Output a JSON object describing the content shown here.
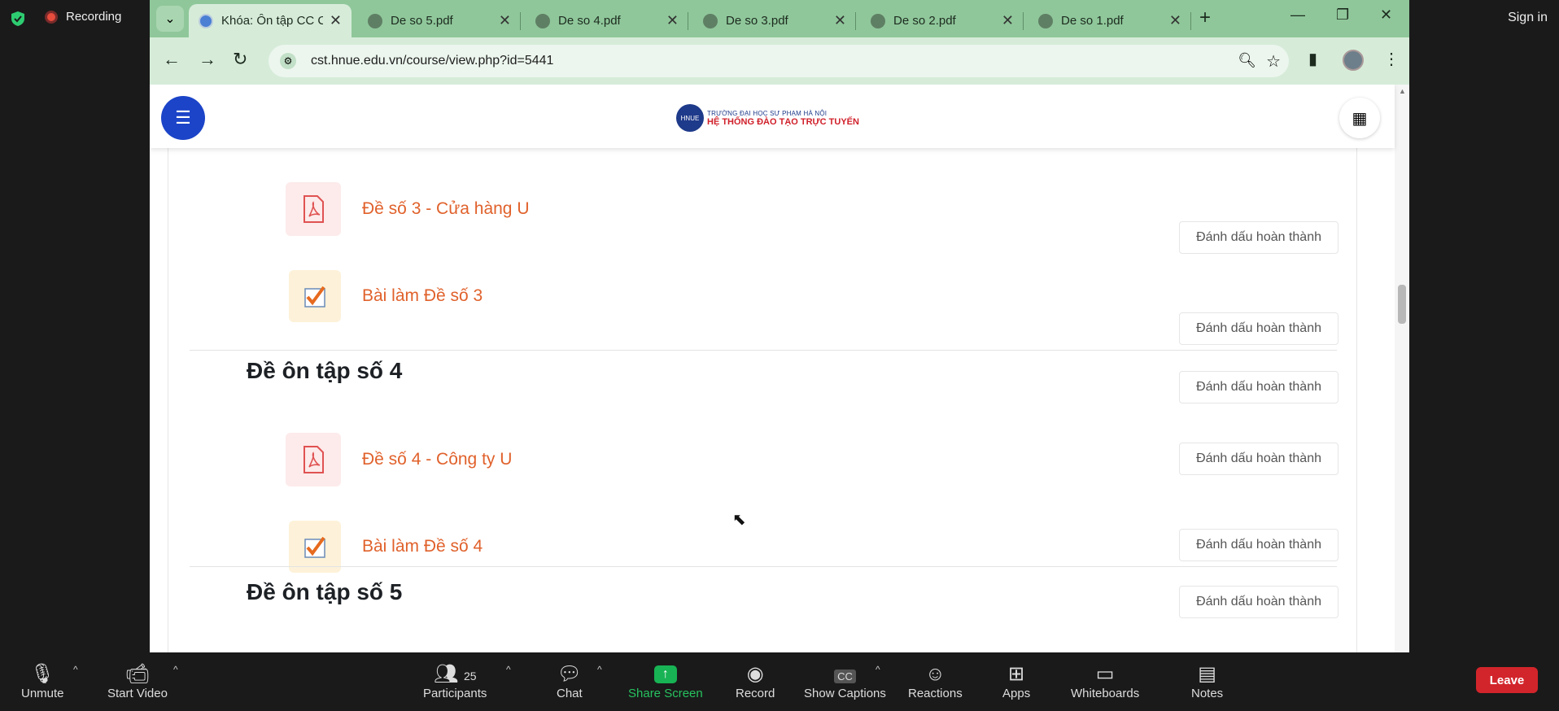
{
  "zoom_top": {
    "recording_label": "Recording",
    "sign_in": "Sign in"
  },
  "browser": {
    "tabs": [
      {
        "title": "Khóa: Ôn tập CC C",
        "active": true
      },
      {
        "title": "De so 5.pdf"
      },
      {
        "title": "De so 4.pdf"
      },
      {
        "title": "De so 3.pdf"
      },
      {
        "title": "De so 2.pdf"
      },
      {
        "title": "De so 1.pdf"
      }
    ],
    "url": "cst.hnue.edu.vn/course/view.php?id=5441"
  },
  "site": {
    "logo_line1": "TRƯỜNG ĐẠI HỌC SƯ PHẠM HÀ NỘI",
    "logo_line2": "HỆ THỐNG ĐÀO TẠO TRỰC TUYẾN",
    "logo_seal": "HNUE"
  },
  "course": {
    "mark_label": "Đánh dấu hoàn thành",
    "items": [
      {
        "type": "pdf",
        "label": "Đề số 3 - Cửa hàng U"
      },
      {
        "type": "assign",
        "label": "Bài làm Đề số 3"
      },
      {
        "type": "section",
        "label": "Đề ôn tập số 4"
      },
      {
        "type": "pdf",
        "label": "Đề số 4 - Công ty U"
      },
      {
        "type": "assign",
        "label": "Bài làm Đề số 4"
      },
      {
        "type": "section",
        "label": "Đề ôn tập số 5"
      }
    ]
  },
  "zoom_bar": {
    "unmute": "Unmute",
    "start_video": "Start Video",
    "participants": "Participants",
    "participants_count": "25",
    "chat": "Chat",
    "share_screen": "Share Screen",
    "record": "Record",
    "show_captions": "Show Captions",
    "captions_glyph": "CC",
    "reactions": "Reactions",
    "apps": "Apps",
    "whiteboards": "Whiteboards",
    "notes": "Notes",
    "leave": "Leave"
  }
}
